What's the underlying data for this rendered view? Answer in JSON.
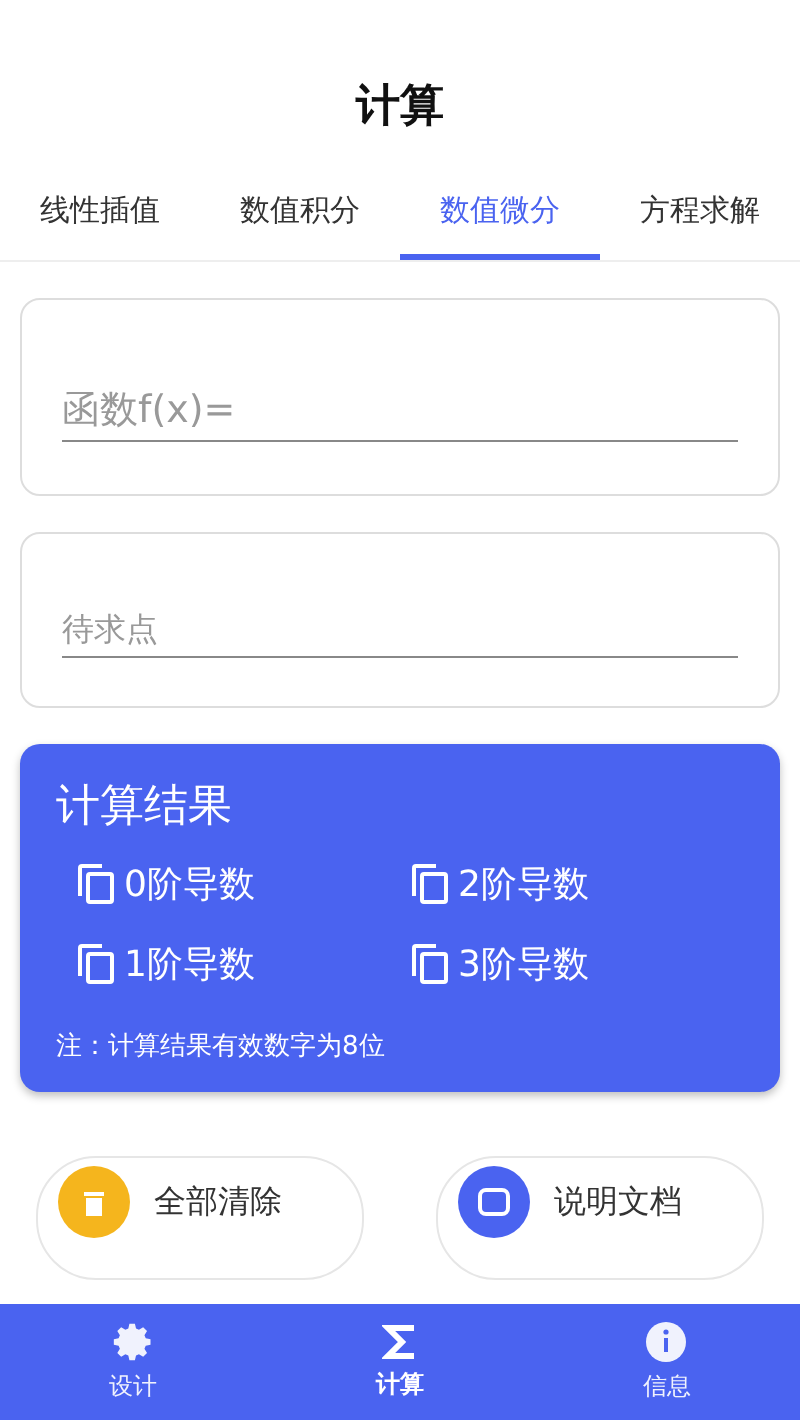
{
  "title": "计算",
  "tabs": [
    {
      "label": "线性插值",
      "selected": false
    },
    {
      "label": "数值积分",
      "selected": false
    },
    {
      "label": "数值微分",
      "selected": true
    },
    {
      "label": "方程求解",
      "selected": false
    }
  ],
  "fields": [
    {
      "placeholder": "函数f(x)=",
      "kind": "large"
    },
    {
      "placeholder": "待求点",
      "kind": "small"
    }
  ],
  "result": {
    "title": "计算结果",
    "items": [
      "0阶导数",
      "2阶导数",
      "1阶导数",
      "3阶导数"
    ],
    "note": "注：计算结果有效数字为8位"
  },
  "actions": [
    {
      "label": "全部清除",
      "kind": "clear"
    },
    {
      "label": "说明文档",
      "kind": "docs"
    }
  ],
  "nav": [
    {
      "label": "设计",
      "kind": "gear",
      "selected": false
    },
    {
      "label": "计算",
      "kind": "sigma",
      "selected": true
    },
    {
      "label": "信息",
      "kind": "info",
      "selected": false
    }
  ]
}
